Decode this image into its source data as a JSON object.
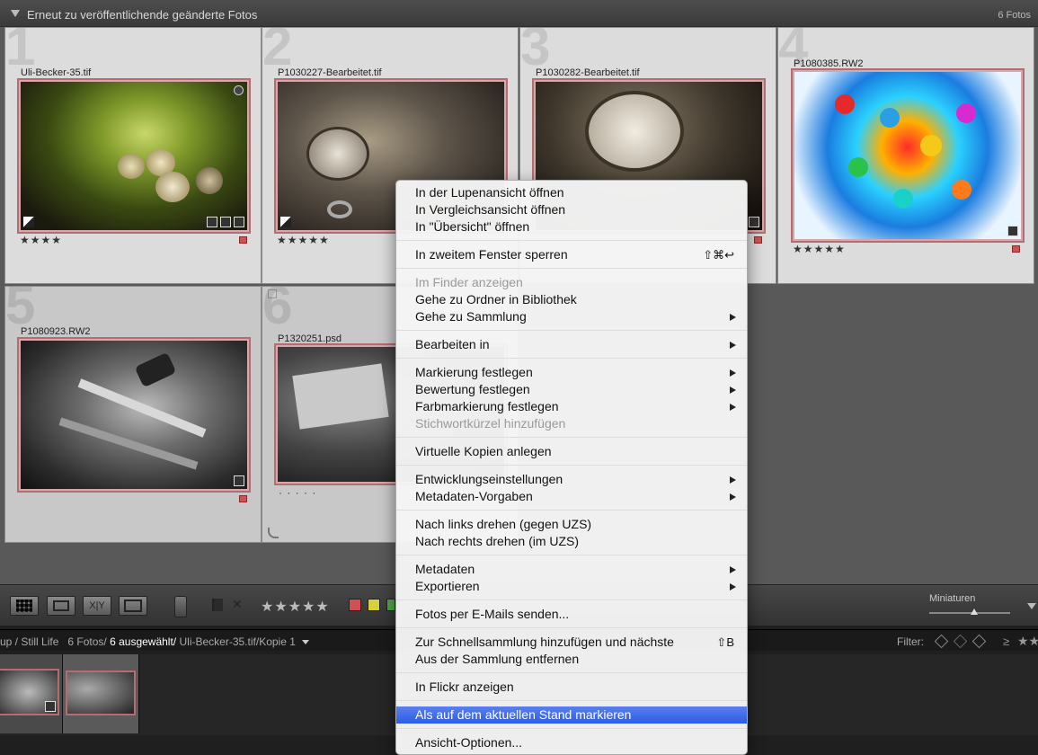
{
  "header": {
    "title": "Erneut zu veröffentlichende geänderte Fotos",
    "count": "6 Fotos"
  },
  "cells": [
    {
      "num": "1",
      "filename": "Uli-Becker-35.tif",
      "stars": "★★★★"
    },
    {
      "num": "2",
      "filename": "P1030227-Bearbeitet.tif",
      "stars": "★★★★★"
    },
    {
      "num": "3",
      "filename": "P1030282-Bearbeitet.tif",
      "stars": ""
    },
    {
      "num": "4",
      "filename": "P1080385.RW2",
      "stars": "★★★★★"
    },
    {
      "num": "5",
      "filename": "P1080923.RW2",
      "stars": ""
    },
    {
      "num": "6",
      "filename": "P1320251.psd",
      "stars": "· · · · ·"
    }
  ],
  "toolbar": {
    "compare_label": "X|Y",
    "rating": "★★★★★",
    "thumbnails_label": "Miniaturen",
    "flag_x": "✕"
  },
  "colors": {
    "label_red": "#d35052",
    "label_yellow": "#d8d23a",
    "label_green": "#4faa45",
    "highlight": "#2c5de5"
  },
  "filmstrip_bar": {
    "path": "up / Still Life",
    "count": "6 Fotos/",
    "selected": "6 ausgewählt/",
    "current": "Uli-Becker-35.tif/Kopie 1",
    "filter_label": "Filter:"
  },
  "menu": {
    "items": [
      {
        "label": "In der Lupenansicht öffnen"
      },
      {
        "label": "In Vergleichsansicht öffnen"
      },
      {
        "label": "In \"Übersicht\" öffnen"
      },
      {
        "label": "In zweitem Fenster sperren",
        "shortcut": "⇧⌘↩"
      },
      {
        "label": "Im Finder anzeigen"
      },
      {
        "label": "Gehe zu Ordner in Bibliothek"
      },
      {
        "label": "Gehe zu Sammlung"
      },
      {
        "label": "Bearbeiten in"
      },
      {
        "label": "Markierung festlegen"
      },
      {
        "label": "Bewertung festlegen"
      },
      {
        "label": "Farbmarkierung festlegen"
      },
      {
        "label": "Stichwortkürzel hinzufügen"
      },
      {
        "label": "Virtuelle Kopien anlegen"
      },
      {
        "label": "Entwicklungseinstellungen"
      },
      {
        "label": "Metadaten-Vorgaben"
      },
      {
        "label": "Nach links drehen (gegen UZS)"
      },
      {
        "label": "Nach rechts drehen (im UZS)"
      },
      {
        "label": "Metadaten"
      },
      {
        "label": "Exportieren"
      },
      {
        "label": "Fotos per E-Mails senden..."
      },
      {
        "label": "Zur Schnellsammlung hinzufügen und nächste",
        "shortcut": "⇧B"
      },
      {
        "label": "Aus der Sammlung entfernen"
      },
      {
        "label": "In Flickr anzeigen"
      },
      {
        "label": "Als auf dem aktuellen Stand markieren"
      },
      {
        "label": "Ansicht-Optionen..."
      }
    ]
  }
}
